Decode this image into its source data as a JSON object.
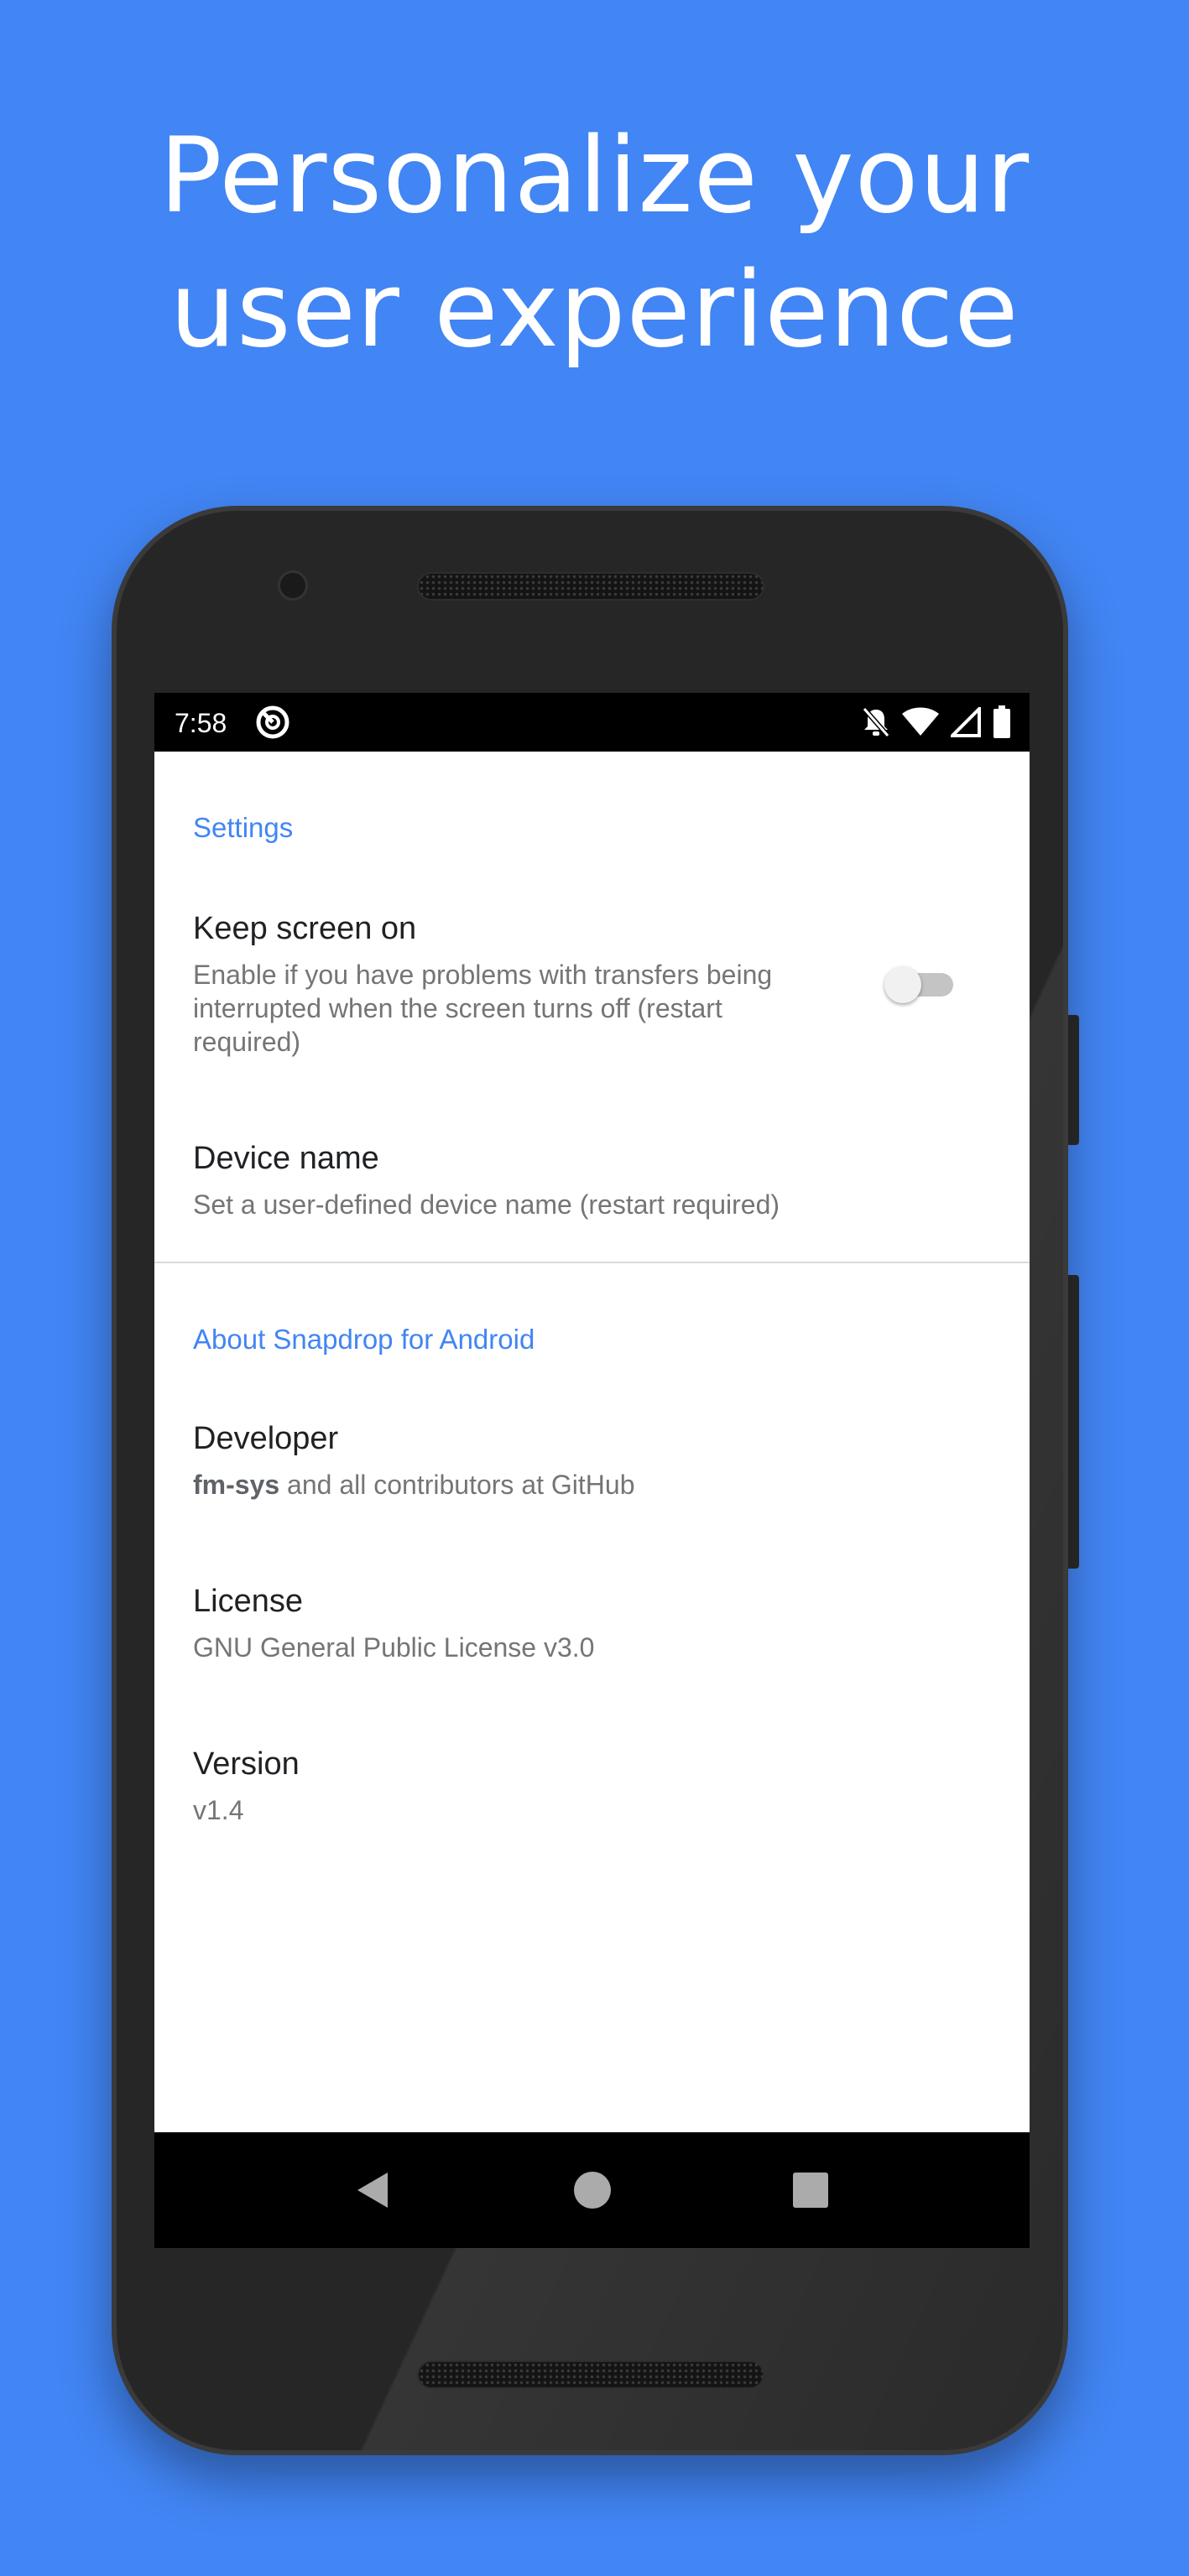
{
  "headline": {
    "line1": "Personalize your",
    "line2": "user experience"
  },
  "status_bar": {
    "time": "7:58",
    "icons": [
      "app-notification-icon",
      "notifications-off-icon",
      "wifi-icon",
      "signal-icon",
      "battery-icon"
    ]
  },
  "settings": {
    "header": "Settings",
    "keep_screen_on": {
      "title": "Keep screen on",
      "summary_line1": "Enable if you have problems with transfers being",
      "summary_line2": "interrupted when the screen turns off (restart",
      "summary_line3": "required)",
      "enabled": false
    },
    "device_name": {
      "title": "Device name",
      "summary": "Set a user-defined device name (restart required)"
    }
  },
  "about": {
    "header": "About Snapdrop for Android",
    "developer": {
      "title": "Developer",
      "summary_bold": "fm-sys",
      "summary_rest": " and all contributors at GitHub"
    },
    "license": {
      "title": "License",
      "summary": "GNU General Public License v3.0"
    },
    "version": {
      "title": "Version",
      "summary": "v1.4"
    }
  },
  "navigation": {
    "buttons": [
      "back-icon",
      "home-icon",
      "recents-icon"
    ]
  },
  "colors": {
    "background": "#4285F4",
    "accent": "#4285F4",
    "title_text": "#202124",
    "summary_text": "#757575"
  }
}
